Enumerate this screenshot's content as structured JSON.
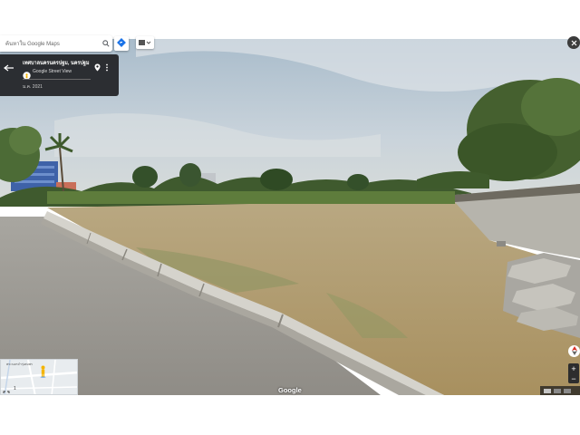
{
  "search": {
    "placeholder": "ค้นหาใน Google Maps"
  },
  "location": {
    "title": "เทศบาลนครนครปฐม, นครปฐม",
    "service_label": "Google Street View",
    "capture_date": "ม.ค. 2021"
  },
  "minimap": {
    "label": "พระนครจำรุ่งสมพร",
    "counter": "1"
  },
  "watermark": "Google",
  "icons": {
    "search": "search-icon",
    "directions": "directions-icon",
    "layers": "layers-icon",
    "close": "close-icon",
    "back": "back-arrow-icon",
    "pin": "location-pin-icon",
    "more": "more-vert-icon",
    "street_view": "street-view-icon",
    "pegman": "pegman-icon",
    "compass": "compass-icon",
    "expand": "expand-icon"
  },
  "controls": {
    "zoom_in": "+",
    "zoom_out": "−"
  },
  "colors": {
    "accent": "#1a73e8",
    "card_bg": "#202124"
  }
}
